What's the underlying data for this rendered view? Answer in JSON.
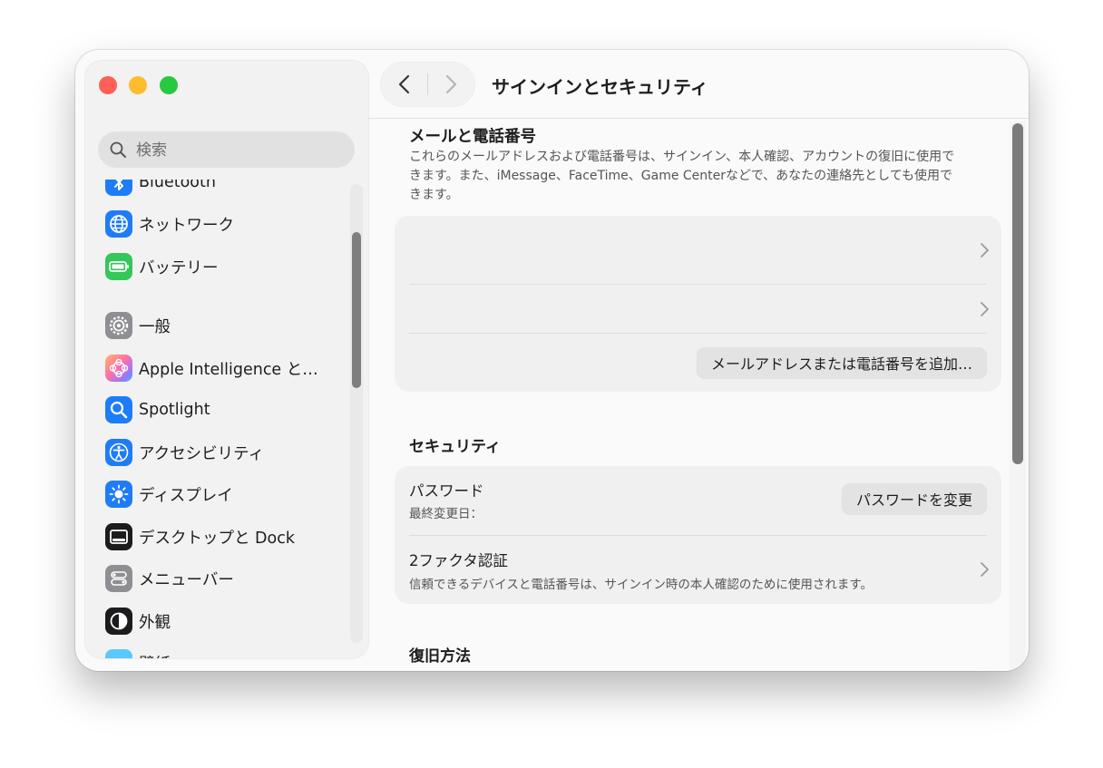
{
  "window": {
    "title": "サインインとセキュリティ"
  },
  "search": {
    "placeholder": "検索"
  },
  "sidebar": {
    "items": [
      {
        "label": "Bluetooth",
        "icon": "bluetooth-icon",
        "color": "#1e7cf7"
      },
      {
        "label": "ネットワーク",
        "icon": "globe-icon",
        "color": "#1e7cf7"
      },
      {
        "label": "バッテリー",
        "icon": "battery-icon",
        "color": "#34c759"
      },
      {
        "label": "一般",
        "icon": "gear-icon",
        "color": "#8e8e93"
      },
      {
        "label": "Apple Intelligence と…",
        "icon": "apple-intelligence-icon",
        "color": "#f0a0c8"
      },
      {
        "label": "Spotlight",
        "icon": "magnifier-icon",
        "color": "#1e7cf7"
      },
      {
        "label": "アクセシビリティ",
        "icon": "accessibility-icon",
        "color": "#1e7cf7"
      },
      {
        "label": "ディスプレイ",
        "icon": "sun-icon",
        "color": "#1e7cf7"
      },
      {
        "label": "デスクトップと Dock",
        "icon": "dock-icon",
        "color": "#1c1c1e"
      },
      {
        "label": "メニューバー",
        "icon": "menubar-icon",
        "color": "#8e8e93"
      },
      {
        "label": "外観",
        "icon": "appearance-icon",
        "color": "#1c1c1e"
      },
      {
        "label": "壁紙",
        "icon": "wallpaper-icon",
        "color": "#5ac8fa"
      }
    ]
  },
  "email_section": {
    "title": "メールと電話番号",
    "description": "これらのメールアドレスおよび電話番号は、サインイン、本人確認、アカウントの復旧に使用できます。また、iMessage、FaceTime、Game Centerなどで、あなたの連絡先としても使用できます。",
    "add_button": "メールアドレスまたは電話番号を追加…"
  },
  "security_section": {
    "title": "セキュリティ",
    "password_title": "パスワード",
    "password_sub": "最終変更日：",
    "change_password_button": "パスワードを変更",
    "twofactor_title": "2ファクタ認証",
    "twofactor_sub": "信頼できるデバイスと電話番号は、サインイン時の本人確認のために使用されます。"
  },
  "recovery_section": {
    "title": "復旧方法"
  }
}
